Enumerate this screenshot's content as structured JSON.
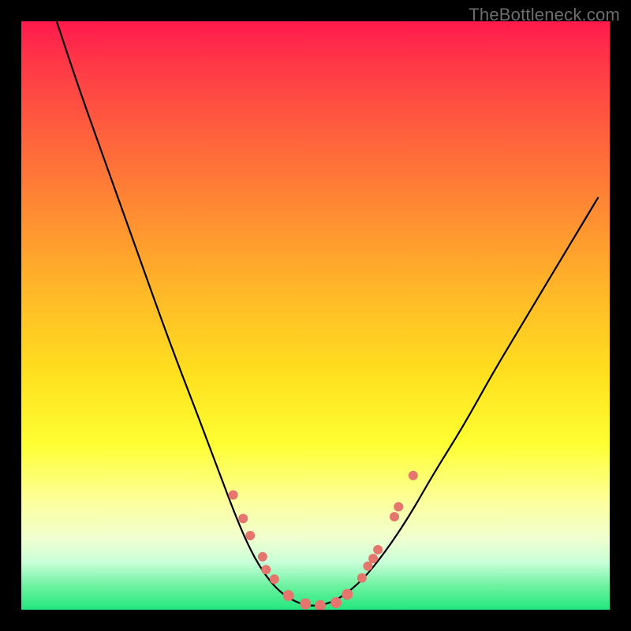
{
  "watermark": "TheBottleneck.com",
  "chart_data": {
    "type": "line",
    "title": "",
    "xlabel": "",
    "ylabel": "",
    "xlim": [
      0,
      100
    ],
    "ylim": [
      0,
      100
    ],
    "series": [
      {
        "name": "bottleneck-curve",
        "x": [
          6,
          10,
          15,
          20,
          25,
          30,
          33,
          36,
          38.5,
          41,
          43.5,
          46,
          48.5,
          51,
          54,
          58,
          62,
          66,
          70,
          75,
          80,
          86,
          92,
          98
        ],
        "y": [
          100,
          88,
          74,
          60,
          46,
          33,
          25,
          17,
          11,
          6.5,
          3.4,
          1.6,
          0.7,
          0.7,
          1.8,
          5,
          10,
          16,
          23,
          31,
          40,
          50,
          60,
          70
        ]
      }
    ],
    "markers": {
      "name": "highlighted-points",
      "color": "#e5766d",
      "points": [
        {
          "x": 36.0,
          "y": 19.5,
          "r": 6
        },
        {
          "x": 37.7,
          "y": 15.5,
          "r": 6
        },
        {
          "x": 38.9,
          "y": 12.6,
          "r": 6
        },
        {
          "x": 41.0,
          "y": 9.0,
          "r": 6
        },
        {
          "x": 41.6,
          "y": 6.8,
          "r": 6
        },
        {
          "x": 43.0,
          "y": 5.2,
          "r": 6
        },
        {
          "x": 45.4,
          "y": 2.4,
          "r": 7
        },
        {
          "x": 48.3,
          "y": 1.0,
          "r": 7
        },
        {
          "x": 50.8,
          "y": 0.7,
          "r": 7
        },
        {
          "x": 53.5,
          "y": 1.2,
          "r": 7
        },
        {
          "x": 55.4,
          "y": 2.6,
          "r": 7
        },
        {
          "x": 57.9,
          "y": 5.4,
          "r": 6
        },
        {
          "x": 58.9,
          "y": 7.4,
          "r": 6
        },
        {
          "x": 59.8,
          "y": 8.7,
          "r": 6
        },
        {
          "x": 60.6,
          "y": 10.2,
          "r": 6
        },
        {
          "x": 63.4,
          "y": 15.8,
          "r": 6
        },
        {
          "x": 64.1,
          "y": 17.5,
          "r": 6
        },
        {
          "x": 66.6,
          "y": 22.8,
          "r": 6
        }
      ]
    },
    "colors": {
      "gradient_top": "#ff1a4d",
      "gradient_bottom": "#23e77e",
      "curve": "#000000",
      "marker": "#e5766d",
      "frame": "#000000"
    }
  }
}
